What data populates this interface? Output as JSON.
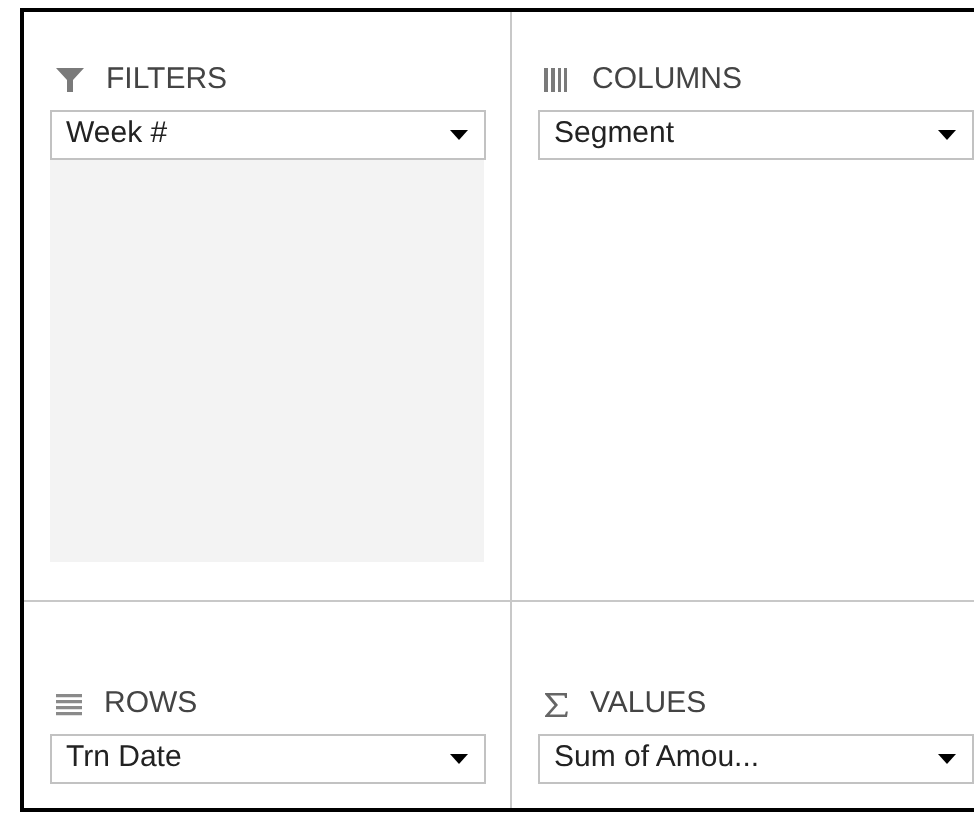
{
  "areas": [
    {
      "kind": "filters",
      "title": "FILTERS",
      "fields": [
        "Week #"
      ]
    },
    {
      "kind": "columns",
      "title": "COLUMNS",
      "fields": [
        "Segment"
      ]
    },
    {
      "kind": "rows",
      "title": "ROWS",
      "fields": [
        "Trn Date"
      ]
    },
    {
      "kind": "values",
      "title": "VALUES",
      "fields": [
        "Sum of Amou..."
      ]
    }
  ]
}
